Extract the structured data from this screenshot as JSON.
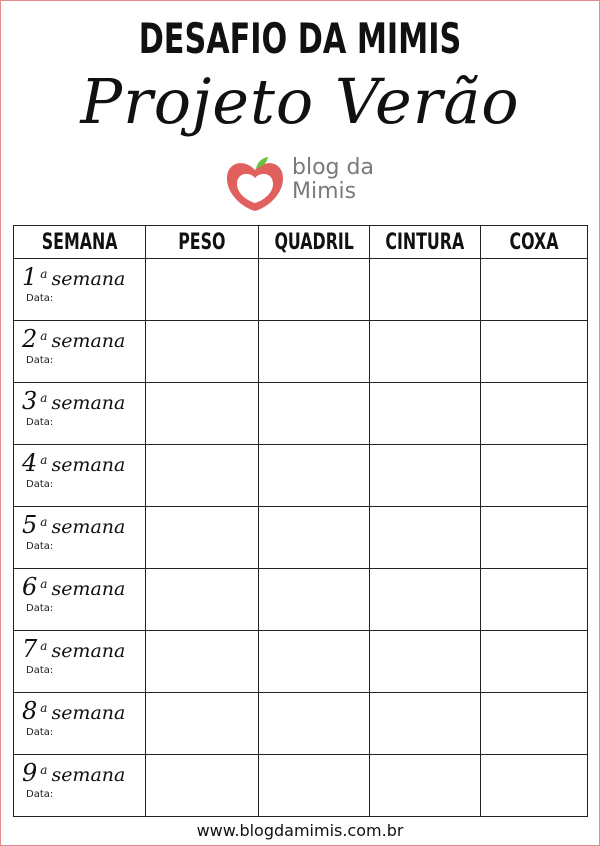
{
  "title": "DESAFIO DA MIMIS",
  "subtitle": "Projeto Verão",
  "logo": {
    "line1": "blog da",
    "line2": "Mimis",
    "icon": "apple-heart-icon",
    "color": "#e0605e",
    "leaf_color": "#6cbf3f"
  },
  "table": {
    "headers": [
      "SEMANA",
      "PESO",
      "QUADRIL",
      "CINTURA",
      "COXA"
    ],
    "rows": [
      {
        "num": "1",
        "ord": "a",
        "label": "semana",
        "date_label": "Data:"
      },
      {
        "num": "2",
        "ord": "a",
        "label": "semana",
        "date_label": "Data:"
      },
      {
        "num": "3",
        "ord": "a",
        "label": "semana",
        "date_label": "Data:"
      },
      {
        "num": "4",
        "ord": "a",
        "label": "semana",
        "date_label": "Data:"
      },
      {
        "num": "5",
        "ord": "a",
        "label": "semana",
        "date_label": "Data:"
      },
      {
        "num": "6",
        "ord": "a",
        "label": "semana",
        "date_label": "Data:"
      },
      {
        "num": "7",
        "ord": "a",
        "label": "semana",
        "date_label": "Data:"
      },
      {
        "num": "8",
        "ord": "a",
        "label": "semana",
        "date_label": "Data:"
      },
      {
        "num": "9",
        "ord": "a",
        "label": "semana",
        "date_label": "Data:"
      }
    ]
  },
  "footer": "www.blogdamimis.com.br",
  "colors": {
    "border": "#e48b8b",
    "accent": "#e0605e"
  }
}
